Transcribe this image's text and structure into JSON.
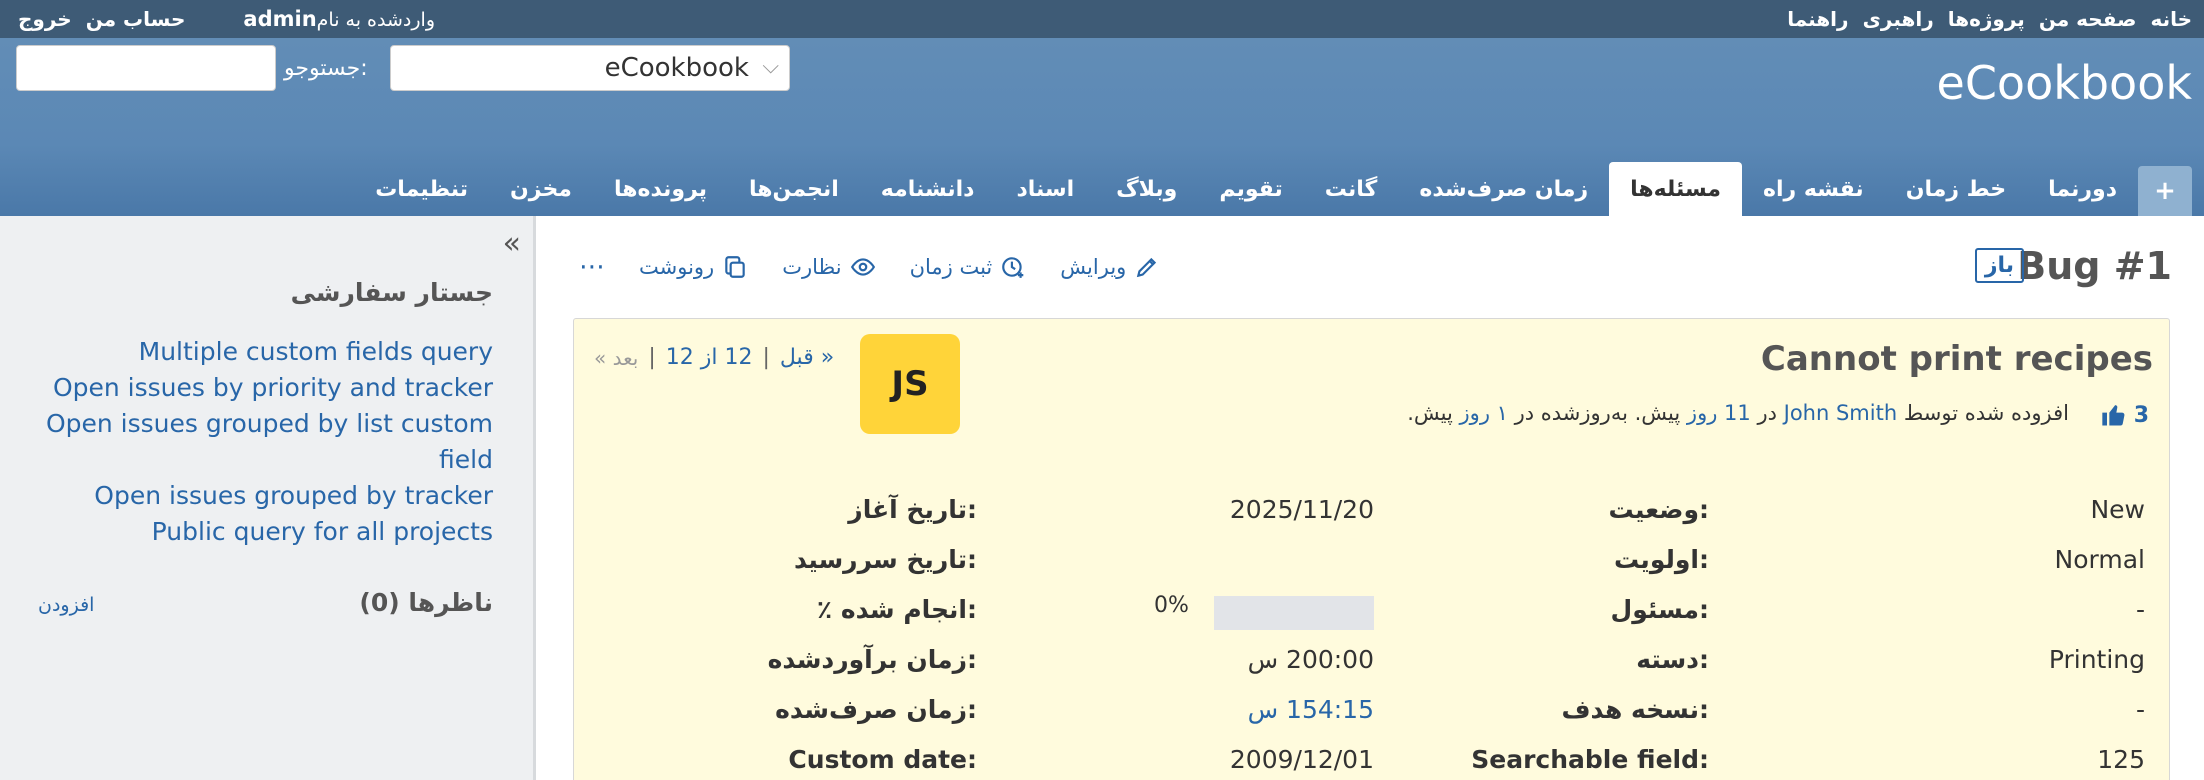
{
  "top_menu": {
    "home": "خانه",
    "my_page": "صفحه من",
    "projects": "پروژه‌ها",
    "administration": "راهبری",
    "help": "راهنما",
    "logged_as_prefix": "واردشده به نام",
    "user": "admin",
    "my_account": "حساب من",
    "logout": "خروج"
  },
  "header": {
    "title": "eCookbook",
    "search_label": "جستوجو:",
    "search_value": "",
    "project_jump_value": "eCookbook"
  },
  "main_menu": {
    "plus": "+",
    "tabs": [
      "دورنما",
      "خط زمان",
      "نقشه راه",
      "مسئله‌ها",
      "زمان صرف‌شده",
      "گانت",
      "تقویم",
      "وبلاگ",
      "اسناد",
      "دانشنامه",
      "انجمن‌ها",
      "پرونده‌ها",
      "مخزن",
      "تنظیمات"
    ],
    "selected": "مسئله‌ها"
  },
  "sidebar": {
    "collapse_icon": "double-chevron-icon",
    "custom_queries_title": "جستار سفارشی",
    "queries": [
      "Multiple custom fields query",
      "Open issues by priority and tracker",
      "Open issues grouped by list custom field",
      "Open issues grouped by tracker",
      "Public query for all projects"
    ],
    "watchers_title": "ناظرها (0)",
    "add_watcher": "افزودن"
  },
  "issue": {
    "title": "Bug #1",
    "status_badge": "باز",
    "actions": {
      "edit": "ویرایش",
      "log_time": "ثبت زمان",
      "watch": "نظارت",
      "copy": "رونوشت",
      "more": "⋯"
    },
    "subject": "Cannot print recipes",
    "votes": "3",
    "author_text_added": "افزوده شده توسط",
    "author": "John Smith",
    "author_in": "در",
    "created_ago": "11 روز",
    "ago_updated": "پیش. به‌روزشده در",
    "updated_ago": "۱ روز",
    "ago_end": "پیش.",
    "avatar": "JS",
    "pager": {
      "prev": "« قبل",
      "position": "12 از 12",
      "next": "بعد »"
    },
    "attributes": {
      "status_label": "وضعیت:",
      "status": "New",
      "priority_label": "اولویت:",
      "priority": "Normal",
      "assignee_label": "مسئول:",
      "assignee": "-",
      "category_label": "دسته:",
      "category": "Printing",
      "target_version_label": "نسخه هدف:",
      "target_version": "-",
      "searchable_label": "Searchable field:",
      "searchable": "125",
      "start_date_label": "تاریخ آغاز:",
      "start_date": "2025/11/20",
      "due_date_label": "تاریخ سررسید:",
      "due_date": "",
      "done_label": "٪ انجام شده:",
      "done": "0%",
      "done_ratio": 0,
      "estimated_label": "زمان برآوردشده:",
      "estimated": "200:00 س",
      "spent_label": "زمان صرف‌شده:",
      "spent": "154:15 س",
      "custom_date_label": "Custom date:",
      "custom_date": "2009/12/01"
    }
  }
}
